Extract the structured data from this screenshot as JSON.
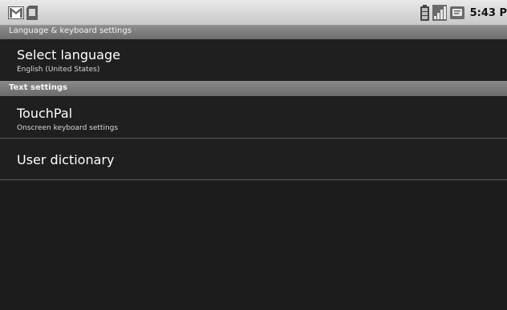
{
  "status_bar": {
    "time": "5:43 P",
    "icons": [
      "gmail-icon",
      "sd-card-icon",
      "battery-icon",
      "signal-icon",
      "message-icon"
    ]
  },
  "title_bar": {
    "title": "Language & keyboard settings"
  },
  "list": {
    "select_language": {
      "title": "Select language",
      "summary": "English (United States)"
    },
    "section_header": "Text settings",
    "touchpal": {
      "title": "TouchPal",
      "summary": "Onscreen keyboard settings"
    },
    "user_dictionary": {
      "title": "User dictionary"
    }
  },
  "colors": {
    "background": "#1d1d1d",
    "header_bar": "#7a7a7a",
    "status_bar": "#d8d8d8",
    "primary_text": "#ffffff",
    "secondary_text": "#d8d8d8"
  }
}
